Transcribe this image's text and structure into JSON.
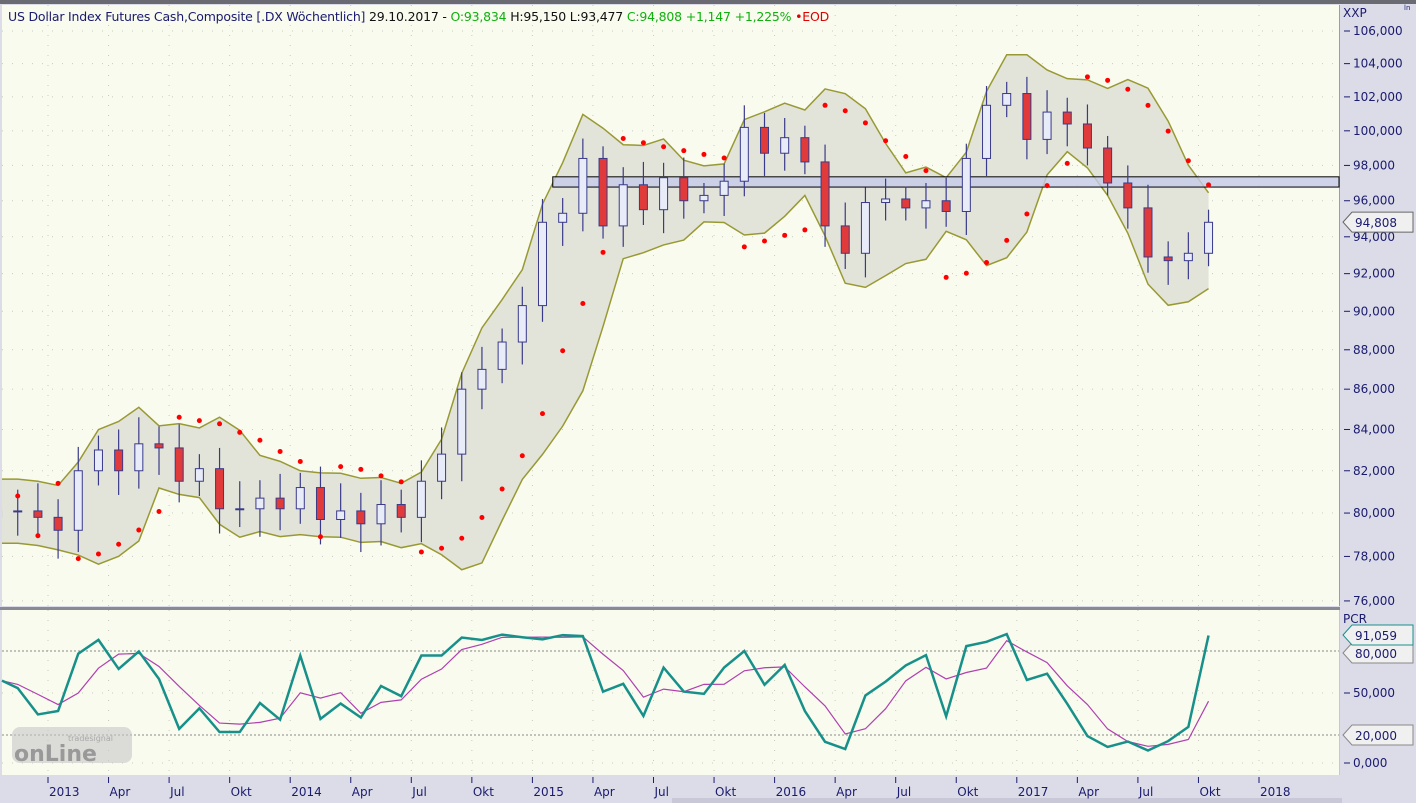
{
  "header": {
    "instrument": "US Dollar Index Futures Cash,Composite [.DX Wöchentlich]",
    "date": "29.10.2017",
    "dash": "-",
    "open": "O:93,834",
    "high": "H:95,150",
    "low": "L:93,477",
    "close": "C:94,808",
    "change": "+1,147",
    "change_pct": "+1,225%",
    "dot": "•",
    "mode": "EOD"
  },
  "colors": {
    "up_body": "#e8ecf8",
    "down_body": "#e03a3a",
    "candle_outline": "#3a3a8a",
    "band_line": "#999933",
    "band_fill": "#e2e4da",
    "sar": "#ff0000",
    "oscillator": "#17908a",
    "signal": "#b040b0",
    "zone_fill": "#c6cae8",
    "plot_bg": "#f8fbee"
  },
  "price_axis": {
    "label": "XXP",
    "scale_note": "ln",
    "ticks": [
      "106,000",
      "104,000",
      "102,000",
      "100,000",
      "98,000",
      "96,000",
      "94,000",
      "92,000",
      "90,000",
      "88,000",
      "86,000",
      "84,000",
      "82,000",
      "80,000",
      "78,000",
      "76,000"
    ],
    "last_value": "94,808"
  },
  "osc_axis": {
    "label": "PCR",
    "ticks": [
      "80,000",
      "50,000",
      "20,000",
      "0,000"
    ],
    "last_value": "91,059",
    "marker_80": "80,000",
    "marker_20": "20,000"
  },
  "time_axis": {
    "ticks": [
      {
        "label": "2013",
        "date": "2013-01"
      },
      {
        "label": "Apr",
        "date": "2013-04"
      },
      {
        "label": "Jul",
        "date": "2013-07"
      },
      {
        "label": "Okt",
        "date": "2013-10"
      },
      {
        "label": "2014",
        "date": "2014-01"
      },
      {
        "label": "Apr",
        "date": "2014-04"
      },
      {
        "label": "Jul",
        "date": "2014-07"
      },
      {
        "label": "Okt",
        "date": "2014-10"
      },
      {
        "label": "2015",
        "date": "2015-01"
      },
      {
        "label": "Apr",
        "date": "2015-04"
      },
      {
        "label": "Jul",
        "date": "2015-07"
      },
      {
        "label": "Okt",
        "date": "2015-10"
      },
      {
        "label": "2016",
        "date": "2016-01"
      },
      {
        "label": "Apr",
        "date": "2016-04"
      },
      {
        "label": "Jul",
        "date": "2016-07"
      },
      {
        "label": "Okt",
        "date": "2016-10"
      },
      {
        "label": "2017",
        "date": "2017-01"
      },
      {
        "label": "Apr",
        "date": "2017-04"
      },
      {
        "label": "Jul",
        "date": "2017-07"
      },
      {
        "label": "Okt",
        "date": "2017-10"
      },
      {
        "label": "2018",
        "date": "2018-01"
      }
    ]
  },
  "watermark": {
    "small": "tradesignal",
    "big": "onLine"
  },
  "chart_data": {
    "type": "candlestick",
    "yscale": "log",
    "ylim": [
      76,
      106
    ],
    "osc_ylim": [
      0,
      100
    ],
    "osc_levels": [
      80,
      20
    ],
    "zone": {
      "from": "2015-03",
      "low": 96.77,
      "high": 97.35
    },
    "grid": true,
    "x": [
      "2012-10",
      "2012-11",
      "2012-12",
      "2013-01",
      "2013-02",
      "2013-03",
      "2013-04",
      "2013-05",
      "2013-06",
      "2013-07",
      "2013-08",
      "2013-09",
      "2013-10",
      "2013-11",
      "2013-12",
      "2014-01",
      "2014-02",
      "2014-03",
      "2014-04",
      "2014-05",
      "2014-06",
      "2014-07",
      "2014-08",
      "2014-09",
      "2014-10",
      "2014-11",
      "2014-12",
      "2015-01",
      "2015-02",
      "2015-03",
      "2015-04",
      "2015-05",
      "2015-06",
      "2015-07",
      "2015-08",
      "2015-09",
      "2015-10",
      "2015-11",
      "2015-12",
      "2016-01",
      "2016-02",
      "2016-03",
      "2016-04",
      "2016-05",
      "2016-06",
      "2016-07",
      "2016-08",
      "2016-09",
      "2016-10",
      "2016-11",
      "2016-12",
      "2017-01",
      "2017-02",
      "2017-03",
      "2017-04",
      "2017-05",
      "2017-06",
      "2017-07",
      "2017-08",
      "2017-09",
      "2017-10"
    ],
    "close": [
      80.1,
      80.1,
      79.8,
      79.2,
      82.0,
      83.0,
      82.0,
      83.3,
      83.1,
      81.5,
      82.1,
      80.2,
      80.2,
      80.7,
      80.2,
      81.2,
      79.7,
      80.1,
      79.5,
      80.4,
      79.8,
      81.5,
      82.8,
      86.0,
      87.0,
      88.4,
      90.3,
      94.8,
      95.3,
      98.4,
      94.6,
      96.9,
      95.5,
      97.3,
      96.0,
      96.3,
      97.1,
      100.2,
      98.7,
      99.6,
      98.2,
      94.6,
      93.1,
      95.9,
      96.1,
      95.6,
      96.0,
      95.4,
      98.4,
      101.5,
      102.2,
      99.5,
      101.1,
      100.4,
      99.0,
      97.0,
      95.6,
      92.9,
      92.7,
      93.1,
      94.8
    ]
  }
}
